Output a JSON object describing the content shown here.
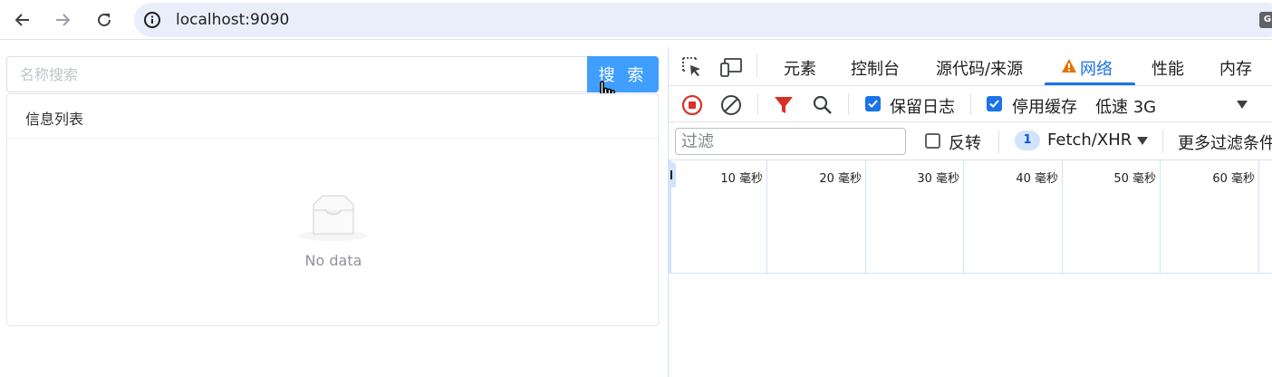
{
  "browser": {
    "url": "localhost:9090",
    "extension_badge": "G"
  },
  "app": {
    "search": {
      "placeholder": "名称搜索",
      "button_label": "搜 索"
    },
    "list": {
      "title": "信息列表",
      "empty_text": "No data"
    },
    "accent_color": "#409eff"
  },
  "devtools": {
    "tabs": [
      {
        "label": "元素"
      },
      {
        "label": "控制台"
      },
      {
        "label": "源代码/来源"
      },
      {
        "label": "网络",
        "active": true,
        "warning": true
      },
      {
        "label": "性能"
      },
      {
        "label": "内存"
      }
    ],
    "toolbar": {
      "preserve_log": {
        "label": "保留日志",
        "checked": true
      },
      "disable_cache": {
        "label": "停用缓存",
        "checked": true
      },
      "throttling": "低速 3G"
    },
    "filter": {
      "placeholder": "过滤",
      "invert": {
        "label": "反转",
        "checked": false
      },
      "type_count": "1",
      "type_label": "Fetch/XHR",
      "more_filters": "更多过滤条件"
    },
    "timeline_ticks": [
      "10 毫秒",
      "20 毫秒",
      "30 毫秒",
      "40 毫秒",
      "50 毫秒",
      "60 毫秒"
    ]
  }
}
